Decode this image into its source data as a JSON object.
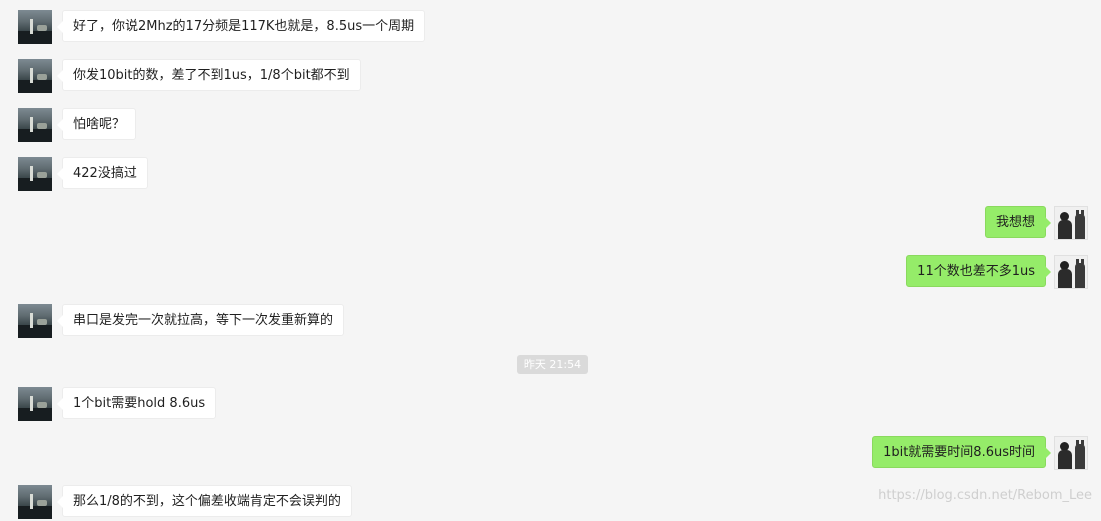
{
  "messages": [
    {
      "side": "left",
      "text": "好了，你说2Mhz的17分频是117K也就是，8.5us一个周期"
    },
    {
      "side": "left",
      "text": "你发10bit的数，差了不到1us，1/8个bit都不到"
    },
    {
      "side": "left",
      "text": "怕啥呢？"
    },
    {
      "side": "left",
      "text": "422没搞过"
    },
    {
      "side": "right",
      "text": "我想想"
    },
    {
      "side": "right",
      "text": "11个数也差不多1us"
    },
    {
      "side": "left",
      "text": "串口是发完一次就拉高，等下一次发重新算的"
    },
    {
      "side": "left",
      "text": "1个bit需要hold 8.6us"
    },
    {
      "side": "right",
      "text": "1bit就需要时间8.6us时间"
    },
    {
      "side": "left",
      "text": "那么1/8的不到，这个偏差收端肯定不会误判的"
    }
  ],
  "timestamp": "昨天  21:54",
  "watermark": "https://blog.csdn.net/Rebom_Lee",
  "colors": {
    "background": "#f5f5f5",
    "incoming_bubble": "#ffffff",
    "outgoing_bubble": "#95ec69",
    "timestamp_bg": "#dadada"
  },
  "icons": {
    "other_avatar": "contact-avatar-icon",
    "self_avatar": "self-avatar-icon"
  }
}
